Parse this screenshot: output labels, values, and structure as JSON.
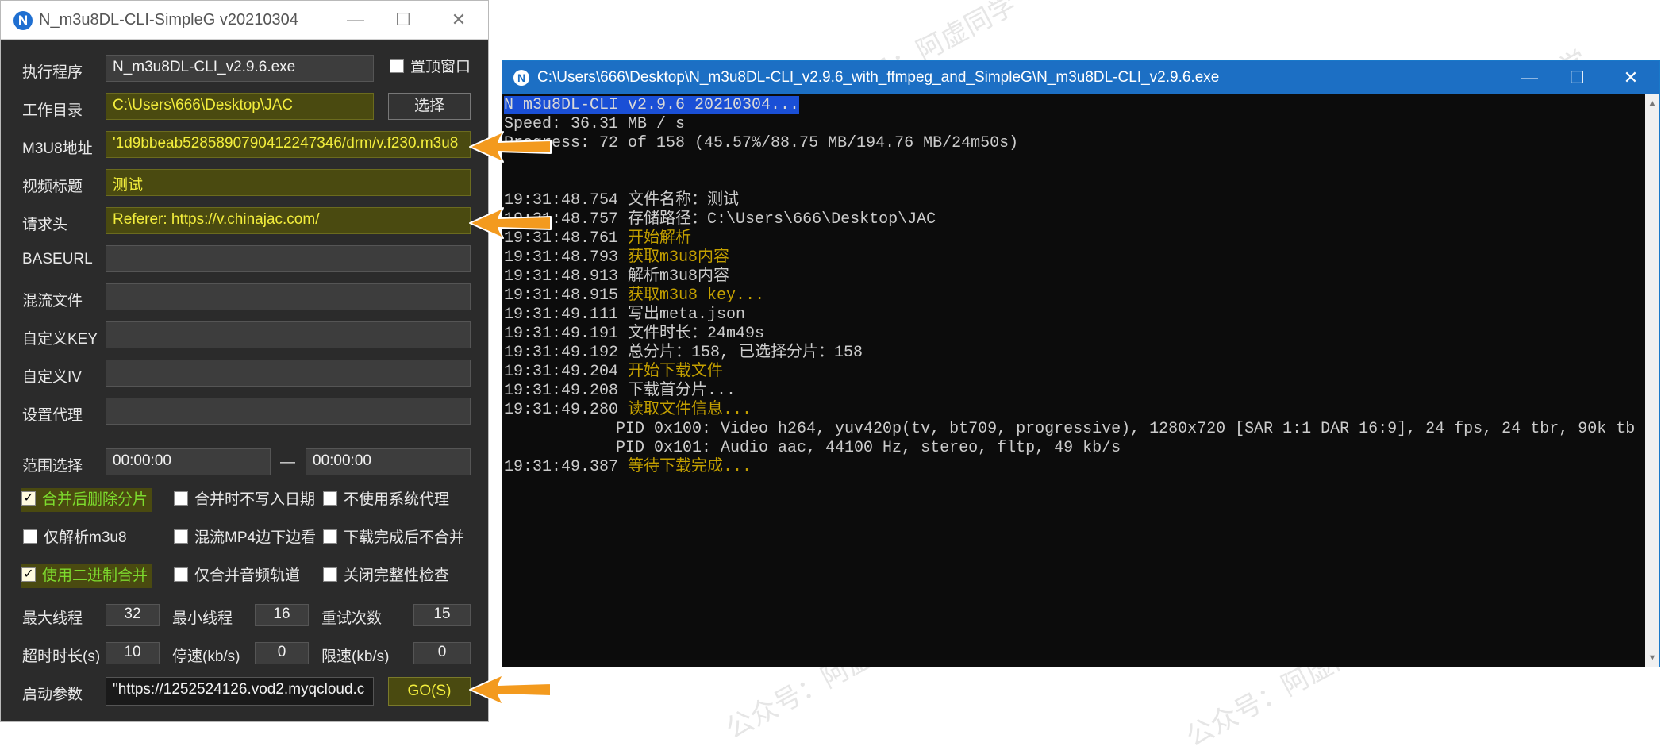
{
  "gui": {
    "title": "N_m3u8DL-CLI-SimpleG v20210304",
    "icon_letter": "N",
    "exe_label": "执行程序",
    "exe_value": "N_m3u8DL-CLI_v2.9.6.exe",
    "topmost_label": "置顶窗口",
    "workdir_label": "工作目录",
    "workdir_value": "C:\\Users\\666\\Desktop\\JAC",
    "choose_button": "选择",
    "m3u8_label": "M3U8地址",
    "m3u8_value": "'1d9bbeab5285890790412247346/drm/v.f230.m3u8",
    "title_label": "视频标题",
    "title_value": "测试",
    "header_label": "请求头",
    "header_value": "Referer: https://v.chinajac.com/",
    "baseurl_label": "BASEURL",
    "mux_label": "混流文件",
    "key_label": "自定义KEY",
    "iv_label": "自定义IV",
    "proxy_label": "设置代理",
    "range_label": "范围选择",
    "range_start": "00:00:00",
    "range_dash": "—",
    "range_end": "00:00:00",
    "checkboxes": [
      {
        "label": "合并后删除分片",
        "checked": true
      },
      {
        "label": "合并时不写入日期",
        "checked": false
      },
      {
        "label": "不使用系统代理",
        "checked": false
      },
      {
        "label": "仅解析m3u8",
        "checked": false
      },
      {
        "label": "混流MP4边下边看",
        "checked": false
      },
      {
        "label": "下载完成后不合并",
        "checked": false
      },
      {
        "label": "使用二进制合并",
        "checked": true
      },
      {
        "label": "仅合并音频轨道",
        "checked": false
      },
      {
        "label": "关闭完整性检查",
        "checked": false
      }
    ],
    "max_threads_label": "最大线程",
    "max_threads": "32",
    "min_threads_label": "最小线程",
    "min_threads": "16",
    "retry_label": "重试次数",
    "retry": "15",
    "timeout_label": "超时时长(s)",
    "timeout": "10",
    "stop_speed_label": "停速(kb/s)",
    "stop_speed": "0",
    "limit_speed_label": "限速(kb/s)",
    "limit_speed": "0",
    "args_label": "启动参数",
    "args_value": "\"https://1252524126.vod2.myqcloud.c",
    "go_button": "GO(S)"
  },
  "console": {
    "icon_letter": "N",
    "title": "C:\\Users\\666\\Desktop\\N_m3u8DL-CLI_v2.9.6_with_ffmpeg_and_SimpleG\\N_m3u8DL-CLI_v2.9.6.exe",
    "header_line": "N_m3u8DL-CLI v2.9.6 20210304...",
    "speed_line": "Speed: 36.31 MB / s",
    "progress_line": "Progress: 72 of 158 (45.57%/88.75 MB/194.76 MB/24m50s)",
    "log": [
      {
        "time": "19:31:48.754",
        "msg": "文件名称：测试",
        "color": "white"
      },
      {
        "time": "19:31:48.757",
        "msg": "存储路径：C:\\Users\\666\\Desktop\\JAC",
        "color": "white"
      },
      {
        "time": "19:31:48.761",
        "msg": "开始解析",
        "color": "orange"
      },
      {
        "time": "19:31:48.793",
        "msg": "获取m3u8内容",
        "color": "orange"
      },
      {
        "time": "19:31:48.913",
        "msg": "解析m3u8内容",
        "color": "white"
      },
      {
        "time": "19:31:48.915",
        "msg": "获取m3u8 key...",
        "color": "orange"
      },
      {
        "time": "19:31:49.111",
        "msg": "写出meta.json",
        "color": "white"
      },
      {
        "time": "19:31:49.191",
        "msg": "文件时长：24m49s",
        "color": "white"
      },
      {
        "time": "19:31:49.192",
        "msg": "总分片：158, 已选择分片：158",
        "color": "white"
      },
      {
        "time": "19:31:49.204",
        "msg": "开始下载文件",
        "color": "orange"
      },
      {
        "time": "19:31:49.208",
        "msg": "下载首分片...",
        "color": "white"
      },
      {
        "time": "19:31:49.280",
        "msg": "读取文件信息...",
        "color": "orange"
      },
      {
        "time": "",
        "msg": "PID 0x100: Video h264, yuv420p(tv, bt709, progressive), 1280x720 [SAR 1:1 DAR 16:9], 24 fps, 24 tbr, 90k tb",
        "color": "white"
      },
      {
        "time": "",
        "msg": "PID 0x101: Audio aac, 44100 Hz, stereo, fltp, 49 kb/s",
        "color": "white"
      },
      {
        "time": "19:31:49.387",
        "msg": "等待下载完成...",
        "color": "orange"
      }
    ]
  },
  "watermark": "公众号：阿虚同学",
  "colors": {
    "accent_orange": "#f39a1e",
    "field_yellow_text": "#f2ed3c",
    "console_orange": "#c4a000",
    "title_blue": "#1c6fc4"
  }
}
